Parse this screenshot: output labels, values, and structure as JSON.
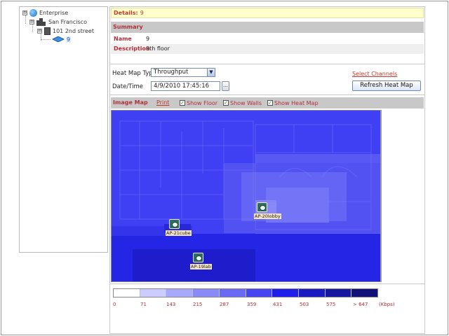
{
  "tree": {
    "nodes": [
      {
        "label": "Enterprise",
        "expander": "⊟"
      },
      {
        "label": "San Francisco",
        "expander": "⊟"
      },
      {
        "label": "101 2nd street",
        "expander": "⊟"
      },
      {
        "label": "9",
        "selected": true
      }
    ]
  },
  "details": {
    "label": "Details:",
    "value": "9"
  },
  "summary": {
    "heading": "Summary",
    "rows": [
      {
        "key": "Name",
        "value": "9"
      },
      {
        "key": "Description",
        "value": "9th floor"
      }
    ]
  },
  "controls": {
    "heatmap_type_label": "Heat Map Type",
    "heatmap_type_value": "Throughput",
    "datetime_label": "Date/Time",
    "datetime_value": "4/9/2010 17:45:16",
    "datetime_button": "...",
    "select_channels": "Select Channels",
    "refresh_button": "Refresh Heat Map"
  },
  "image_map": {
    "heading": "Image Map",
    "print_link": "Print",
    "show_floor": {
      "label": "Show Floor",
      "checked": true
    },
    "show_walls": {
      "label": "Show Walls",
      "checked": true
    },
    "show_heatmap": {
      "label": "Show Heat Map",
      "checked": true
    },
    "access_points": [
      {
        "name": "AP-20lobby"
      },
      {
        "name": "AP-21cube"
      },
      {
        "name": "AP-19lab"
      }
    ]
  },
  "legend": {
    "colors": [
      "#ffffff",
      "#ccccff",
      "#a9a9fb",
      "#8a8af7",
      "#6a6af5",
      "#4545f1",
      "#1f1fe9",
      "#1a1ac2",
      "#16169e",
      "#111178"
    ],
    "labels": [
      "0",
      "71",
      "143",
      "215",
      "287",
      "359",
      "431",
      "503",
      "575",
      "> 647",
      "(Kbps)"
    ]
  },
  "colors": {
    "accent_red": "#b0303a",
    "header_gray": "#c8c8c8",
    "details_bg": "#ffffcc",
    "map_base": "#3f3ff4"
  }
}
